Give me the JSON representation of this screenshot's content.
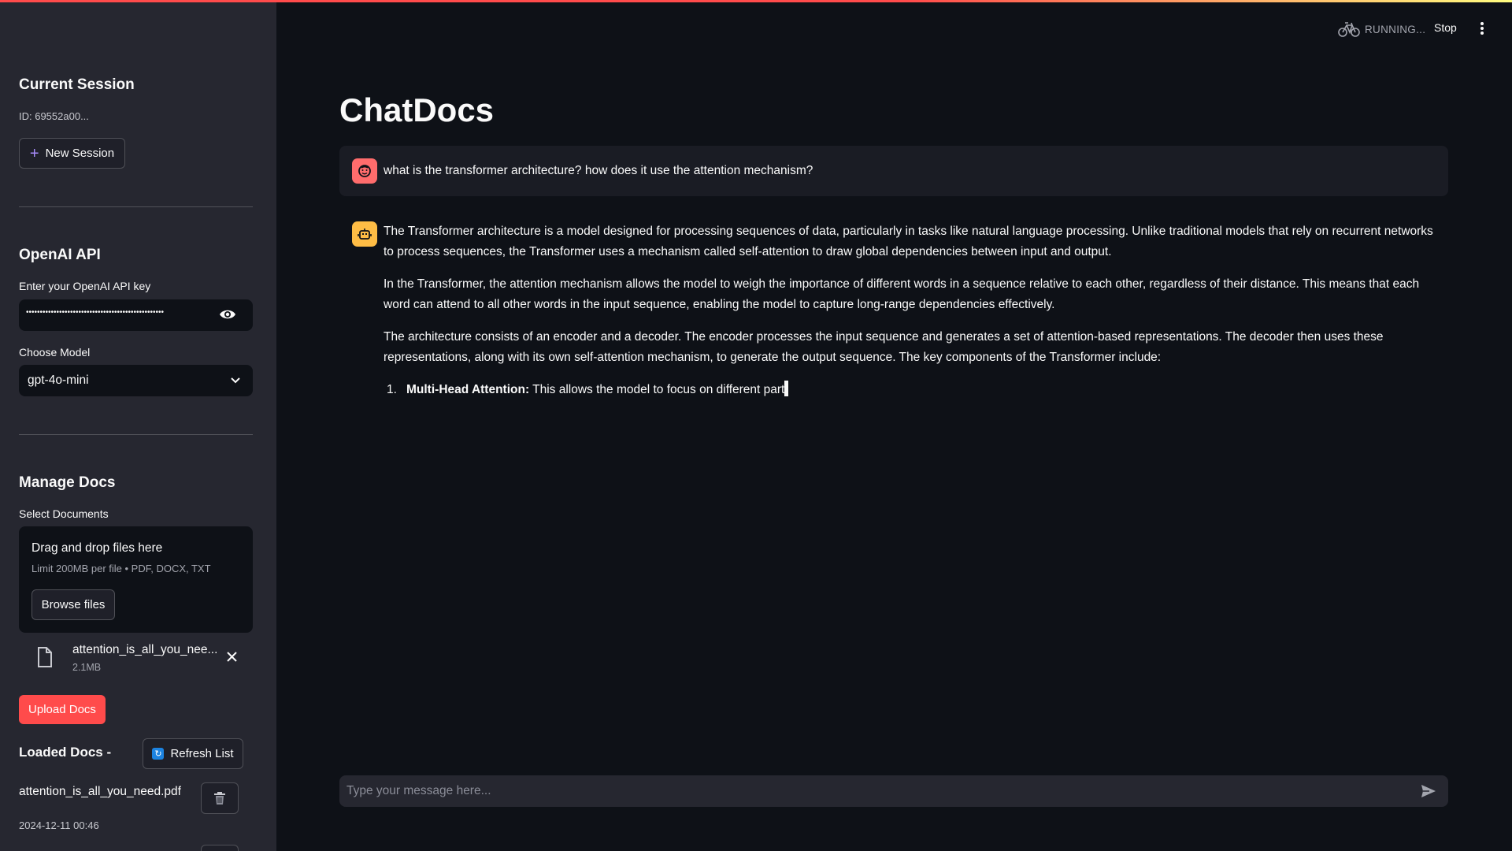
{
  "sidebar": {
    "session_title": "Current Session",
    "session_id": "ID: 69552a00...",
    "new_session_label": "New Session",
    "api_title": "OpenAI API",
    "api_key_label": "Enter your OpenAI API key",
    "api_key_value": "••••••••••••••••••••••••••••••••••••••••••••••••••",
    "model_label": "Choose Model",
    "model_value": "gpt-4o-mini",
    "docs_title": "Manage Docs",
    "select_docs_label": "Select Documents",
    "dropzone_title": "Drag and drop files here",
    "dropzone_limit": "Limit 200MB per file • PDF, DOCX, TXT",
    "browse_label": "Browse files",
    "uploaded_file": {
      "name": "attention_is_all_you_nee...",
      "size": "2.1MB"
    },
    "upload_label": "Upload Docs",
    "loaded_title": "Loaded Docs -",
    "refresh_label": "Refresh List",
    "loaded_docs": [
      {
        "name": "attention_is_all_you_need.pdf",
        "date": "2024-12-11 00:46"
      }
    ]
  },
  "header": {
    "status_text": "RUNNING...",
    "stop_label": "Stop"
  },
  "main": {
    "title": "ChatDocs",
    "user_message": "what is the transformer architecture? how does it use the attention mechanism?",
    "assistant": {
      "p1": "The Transformer architecture is a model designed for processing sequences of data, particularly in tasks like natural language processing. Unlike traditional models that rely on recurrent networks to process sequences, the Transformer uses a mechanism called self-attention to draw global dependencies between input and output.",
      "p2": "In the Transformer, the attention mechanism allows the model to weigh the importance of different words in a sequence relative to each other, regardless of their distance. This means that each word can attend to all other words in the input sequence, enabling the model to capture long-range dependencies effectively.",
      "p3": "The architecture consists of an encoder and a decoder. The encoder processes the input sequence and generates a set of attention-based representations. The decoder then uses these representations, along with its own self-attention mechanism, to generate the output sequence. The key components of the Transformer include:",
      "list_number": "1.",
      "list_bold": "Multi-Head Attention:",
      "list_text": " This allows the model to focus on different part"
    },
    "chat_placeholder": "Type your message here..."
  },
  "colors": {
    "accent": "#ff4b4b",
    "sidebar_bg": "#262730",
    "main_bg": "#0e1117",
    "assistant_avatar": "#ffbd45"
  }
}
